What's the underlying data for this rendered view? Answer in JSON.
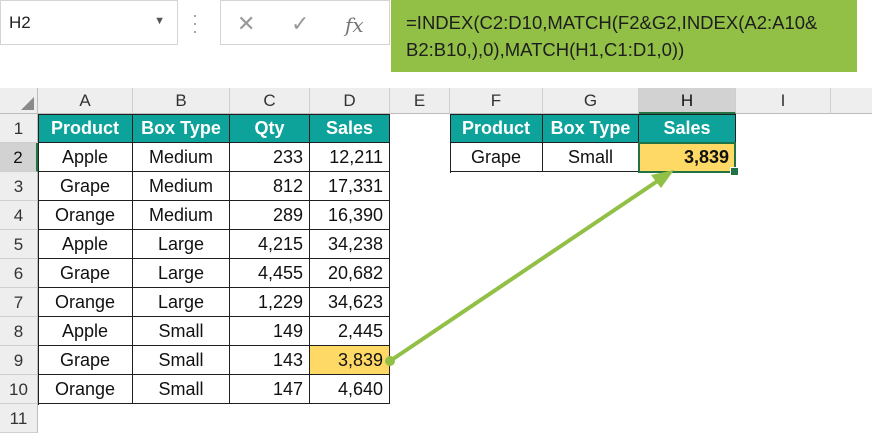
{
  "name_box": {
    "value": "H2"
  },
  "formula_bar": {
    "cancel_icon": "✕",
    "enter_icon": "✓",
    "fx_icon": "fx",
    "formula": "=INDEX(C2:D10,MATCH(F2&G2,INDEX(A2:A10&\nB2:B10,),0),MATCH(H1,C1:D1,0))"
  },
  "columns": [
    "A",
    "B",
    "C",
    "D",
    "E",
    "F",
    "G",
    "H",
    "I"
  ],
  "rows": [
    "1",
    "2",
    "3",
    "4",
    "5",
    "6",
    "7",
    "8",
    "9",
    "10",
    "11"
  ],
  "selected": {
    "column": "H",
    "row": "2"
  },
  "table1": {
    "headers": [
      "Product",
      "Box Type",
      "Qty",
      "Sales"
    ],
    "rows": [
      [
        "Apple",
        "Medium",
        "233",
        "12,211"
      ],
      [
        "Grape",
        "Medium",
        "812",
        "17,331"
      ],
      [
        "Orange",
        "Medium",
        "289",
        "16,390"
      ],
      [
        "Apple",
        "Large",
        "4,215",
        "34,238"
      ],
      [
        "Grape",
        "Large",
        "4,455",
        "20,682"
      ],
      [
        "Orange",
        "Large",
        "1,229",
        "34,623"
      ],
      [
        "Apple",
        "Small",
        "149",
        "2,445"
      ],
      [
        "Grape",
        "Small",
        "143",
        "3,839"
      ],
      [
        "Orange",
        "Small",
        "147",
        "4,640"
      ]
    ]
  },
  "table2": {
    "headers": [
      "Product",
      "Box Type",
      "Sales"
    ],
    "row": [
      "Grape",
      "Small",
      "3,839"
    ]
  },
  "colors": {
    "header_fill": "#0da29a",
    "highlight": "#ffd966",
    "formula_bg": "#92c046",
    "arrow": "#92c046",
    "selection": "#217346"
  }
}
